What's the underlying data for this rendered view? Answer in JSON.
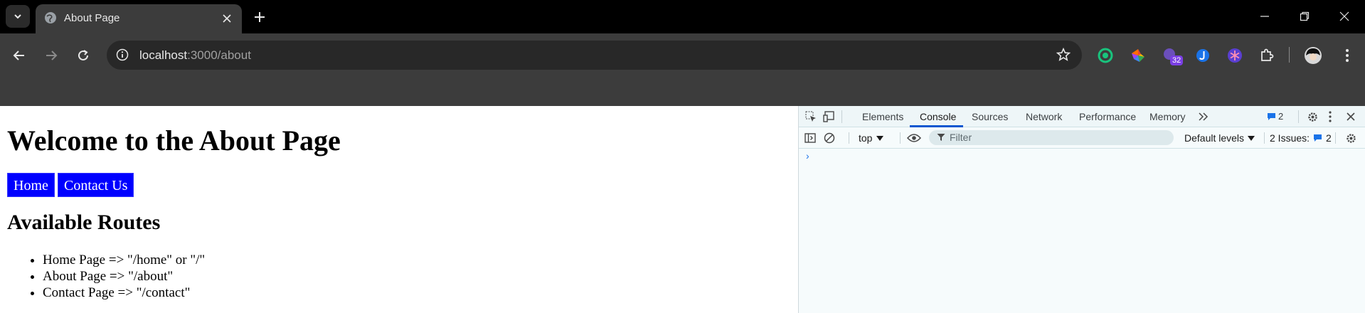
{
  "browser": {
    "tab": {
      "title": "About Page"
    },
    "url": {
      "host": "localhost",
      "path": ":3000/about"
    },
    "extensions": {
      "badge_count": "32"
    }
  },
  "page": {
    "heading": "Welcome to the About Page",
    "buttons": {
      "home": "Home",
      "contact": "Contact Us"
    },
    "routes_heading": "Available Routes",
    "routes": [
      "Home Page => \"/home\" or \"/\"",
      "About Page => \"/about\"",
      "Contact Page => \"/contact\""
    ]
  },
  "devtools": {
    "tabs": [
      "Elements",
      "Console",
      "Sources",
      "Network",
      "Performance",
      "Memory"
    ],
    "active_tab": "Console",
    "message_count": "2",
    "context": "top",
    "filter_placeholder": "Filter",
    "levels": "Default levels",
    "issues_label": "2 Issues:",
    "issues_count": "2",
    "prompt": "›"
  },
  "colors": {
    "button_bg": "#0000ff",
    "active_tab_underline": "#0b57d0",
    "devtools_bg": "#f6fbfc"
  }
}
